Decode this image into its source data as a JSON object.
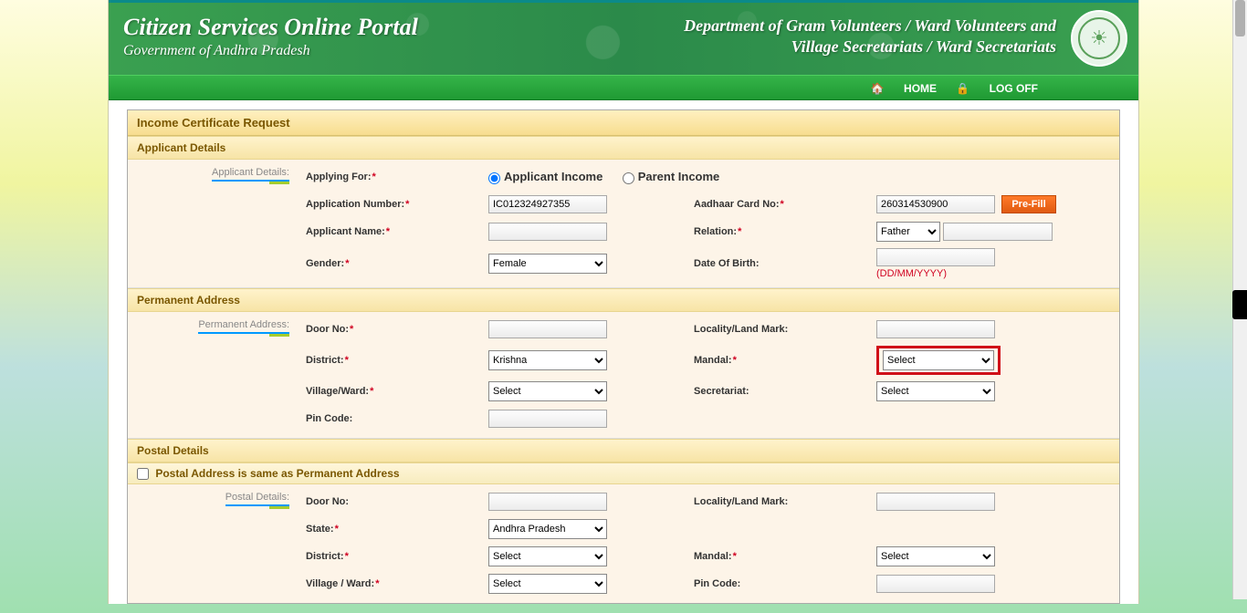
{
  "header": {
    "title": "Citizen Services Online Portal",
    "subtitle": "Government of Andhra Pradesh",
    "dept_line1": "Department of Gram Volunteers / Ward Volunteers and",
    "dept_line2": "Village Secretariats / Ward Secretariats"
  },
  "nav": {
    "home": "HOME",
    "logoff": "LOG OFF"
  },
  "form": {
    "title": "Income Certificate Request",
    "applicant_details": {
      "section_label": "Applicant Details",
      "side_label": "Applicant Details:",
      "applying_for_label": "Applying For:",
      "radio_applicant": "Applicant Income",
      "radio_parent": "Parent Income",
      "app_no_label": "Application Number:",
      "app_no_value": "IC012324927355",
      "aadhaar_label": "Aadhaar Card No:",
      "aadhaar_value": "260314530900",
      "prefill_btn": "Pre-Fill",
      "applicant_name_label": "Applicant Name:",
      "applicant_name_value": "",
      "relation_label": "Relation:",
      "relation_value": "Father",
      "gender_label": "Gender:",
      "gender_value": "Female",
      "dob_label": "Date Of Birth:",
      "dob_hint": "(DD/MM/YYYY)"
    },
    "permanent_address": {
      "section_label": "Permanent Address",
      "side_label": "Permanent Address:",
      "door_no_label": "Door No:",
      "locality_label": "Locality/Land Mark:",
      "district_label": "District:",
      "district_value": "Krishna",
      "mandal_label": "Mandal:",
      "mandal_value": "Select",
      "village_label": "Village/Ward:",
      "village_value": "Select",
      "secretariat_label": "Secretariat:",
      "secretariat_value": "Select",
      "pincode_label": "Pin Code:"
    },
    "postal_details": {
      "section_label": "Postal Details",
      "same_as_label": "Postal Address is same as Permanent Address",
      "side_label": "Postal Details:",
      "door_no_label": "Door No:",
      "locality_label": "Locality/Land Mark:",
      "state_label": "State:",
      "state_value": "Andhra Pradesh",
      "district_label": "District:",
      "district_value": "Select",
      "mandal_label": "Mandal:",
      "mandal_value": "Select",
      "village_label": "Village / Ward:",
      "village_value": "Select",
      "pincode_label": "Pin Code:"
    }
  }
}
